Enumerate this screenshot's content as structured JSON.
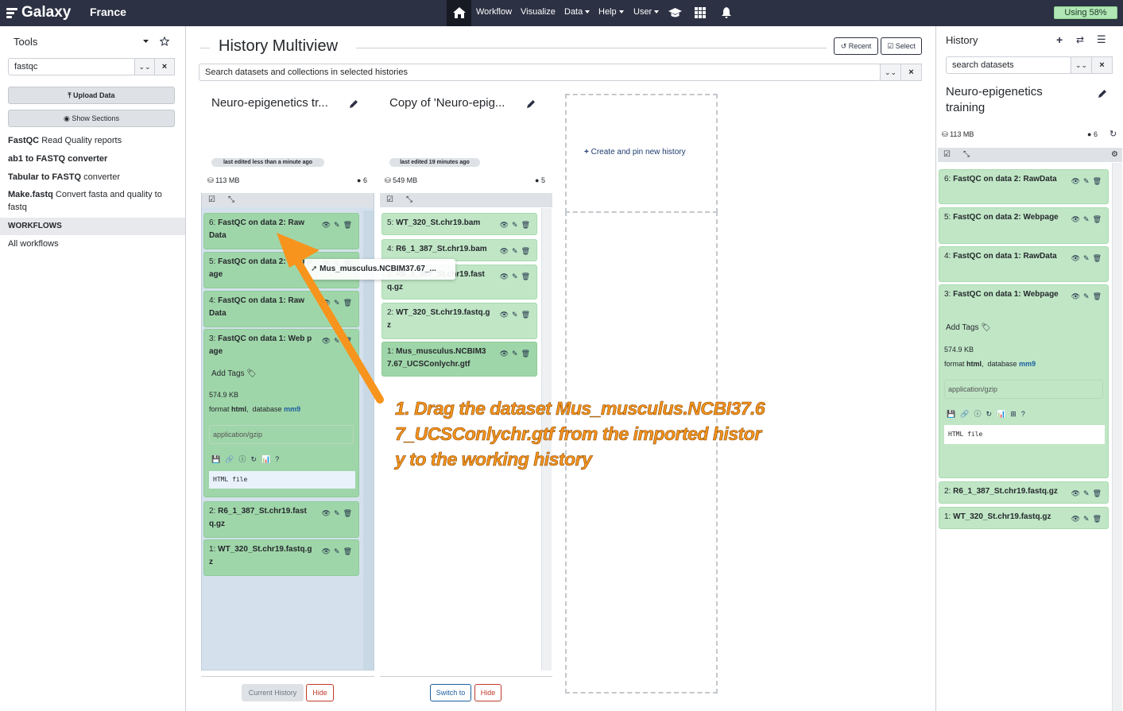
{
  "topbar": {
    "logo": "Galaxy",
    "brand": "France",
    "nav": [
      "Workflow",
      "Visualize",
      "Data",
      "Help",
      "User"
    ],
    "quota": "Using 58%"
  },
  "tools_panel": {
    "title": "Tools",
    "search_value": "fastqc",
    "upload_label": "Upload Data",
    "sections_label": "Show Sections",
    "tools": [
      {
        "name": "FastQC",
        "desc": "Read Quality reports"
      },
      {
        "name": "ab1 to FASTQ converter",
        "desc": ""
      },
      {
        "name": "Tabular to FASTQ",
        "desc": "converter"
      },
      {
        "name": "Make.fastq",
        "desc": "Convert fasta and quality to fastq"
      }
    ],
    "workflows_header": "WORKFLOWS",
    "all_workflows": "All workflows"
  },
  "multiview": {
    "title": "History Multiview",
    "recent_label": "Recent",
    "select_label": "Select",
    "search_placeholder": "Search datasets and collections in selected histories",
    "create_pin": "Create and pin new history",
    "histories": [
      {
        "name": "Neuro-epigenetics tr...",
        "edited": "last edited less than a minute ago",
        "size": "113 MB",
        "count": "6",
        "footer_left": "Current History",
        "footer_right": "Hide",
        "items": [
          {
            "hid": "6:",
            "name": "FastQC on data 2: Raw Data"
          },
          {
            "hid": "5:",
            "name": "FastQC on data 2: Web page"
          },
          {
            "hid": "4:",
            "name": "FastQC on data 1: Raw Data"
          },
          {
            "hid": "3:",
            "name": "FastQC on data 1: Web page",
            "tags": "Add Tags",
            "size": "574.9 KB",
            "format": "html",
            "database": "mm9",
            "peek": "application/gzip",
            "display": "HTML file"
          },
          {
            "hid": "2:",
            "name": "R6_1_387_St.chr19.fastq.gz"
          },
          {
            "hid": "1:",
            "name": "WT_320_St.chr19.fastq.gz"
          }
        ]
      },
      {
        "name": "Copy of 'Neuro-epig...",
        "edited": "last edited 19 minutes ago",
        "size": "549 MB",
        "count": "5",
        "footer_left": "Switch to",
        "footer_right": "Hide",
        "items": [
          {
            "hid": "5:",
            "name": "WT_320_St.chr19.bam"
          },
          {
            "hid": "4:",
            "name": "R6_1_387_St.chr19.bam"
          },
          {
            "hid": "3:",
            "name": "R6_1_387_St.chr19.fastq.gz"
          },
          {
            "hid": "2:",
            "name": "WT_320_St.chr19.fastq.gz"
          },
          {
            "hid": "1:",
            "name": "Mus_musculus.NCBIM37.67_UCSConlychr.gtf"
          }
        ]
      }
    ],
    "drag_label": "Mus_musculus.NCBIM37.67_...",
    "annotation": "1. Drag the dataset Mus_musculus.NCBI37.67_UCSConlychr.gtf from the imported history to the working history"
  },
  "history_panel": {
    "title": "History",
    "search_placeholder": "search datasets",
    "name": "Neuro-epigenetics training",
    "size": "113 MB",
    "count": "6",
    "items": [
      {
        "hid": "6:",
        "name": "FastQC on data 2: RawData"
      },
      {
        "hid": "5:",
        "name": "FastQC on data 2: Webpage"
      },
      {
        "hid": "4:",
        "name": "FastQC on data 1: RawData"
      },
      {
        "hid": "3:",
        "name": "FastQC on data 1: Webpage",
        "tags": "Add Tags",
        "size": "574.9 KB",
        "format": "html",
        "database": "mm9",
        "peek": "application/gzip",
        "display": "HTML file"
      },
      {
        "hid": "2:",
        "name": "R6_1_387_St.chr19.fastq.gz"
      },
      {
        "hid": "1:",
        "name": "WT_320_St.chr19.fastq.gz"
      }
    ]
  },
  "colors": {
    "topbar": "#2c3143",
    "dataset_ok": "#9fd6a9",
    "annotation": "#f7941d"
  }
}
